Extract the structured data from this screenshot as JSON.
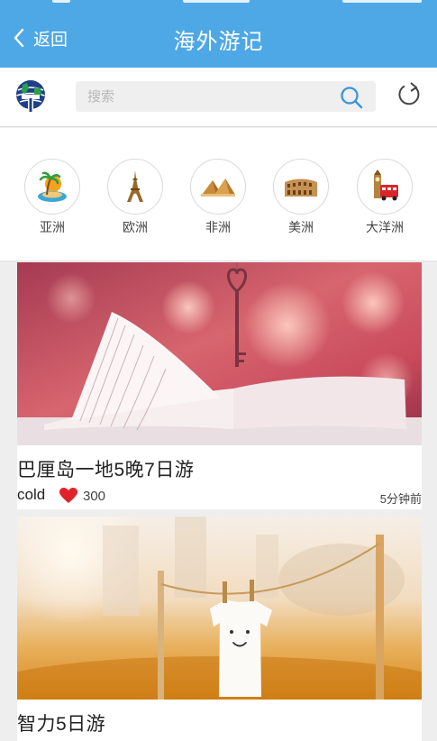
{
  "nav": {
    "back_label": "返回",
    "title": "海外游记"
  },
  "search": {
    "placeholder": "搜索"
  },
  "continents": [
    {
      "label": "亚洲",
      "icon": "palm-island-icon"
    },
    {
      "label": "欧洲",
      "icon": "eiffel-tower-icon"
    },
    {
      "label": "非洲",
      "icon": "pyramids-icon"
    },
    {
      "label": "美洲",
      "icon": "colosseum-icon"
    },
    {
      "label": "大洋洲",
      "icon": "big-ben-bus-icon"
    }
  ],
  "posts": [
    {
      "title": "巴厘岛一地5晚7日游",
      "author": "cold",
      "likes": "300",
      "time": "5分钟前",
      "image": "open-book-with-key-photo"
    },
    {
      "title": "智力5日游",
      "image": "shirt-on-clothesline-photo"
    }
  ],
  "colors": {
    "nav_bar": "#4ea8e6",
    "accent": "#3a95d8",
    "like_heart": "#e0232b",
    "background": "#eeeeee"
  }
}
